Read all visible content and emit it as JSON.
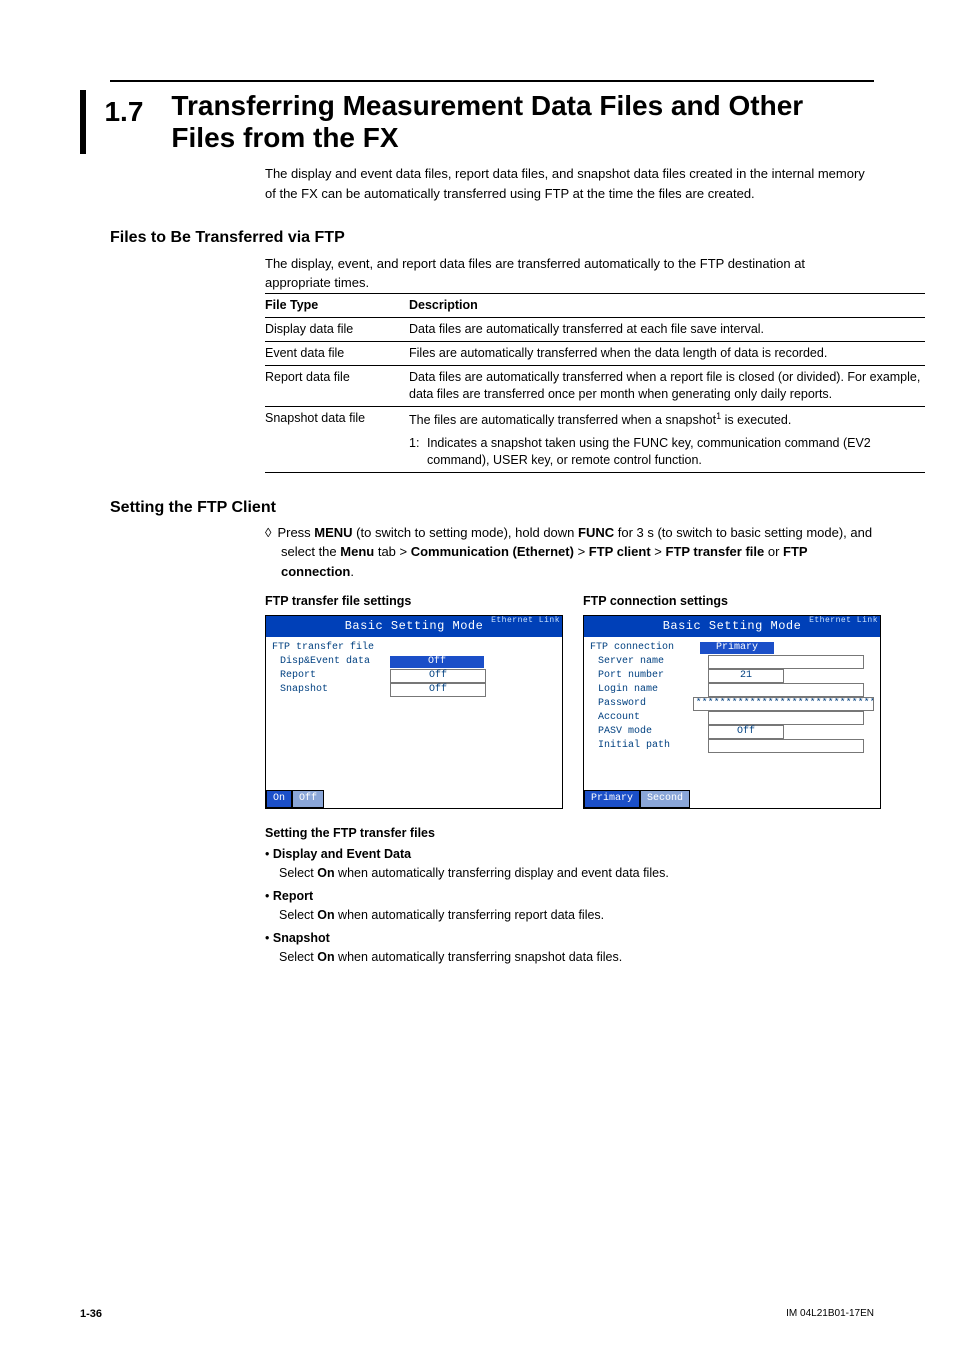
{
  "section_number": "1.7",
  "section_title": "Transferring Measurement Data Files and Other Files from the FX",
  "intro": "The display and event data files, report data files, and snapshot data files created in the internal memory of the FX can be automatically transferred using FTP at the time the files are created.",
  "subhead1": "Files to Be Transferred via FTP",
  "sub1_text": "The display, event, and report data files are transferred automatically to the FTP destination at appropriate times.",
  "table": {
    "h1": "File Type",
    "h2": "Description",
    "rows": [
      {
        "type": "Display data file",
        "desc": "Data files are automatically transferred at each file save interval."
      },
      {
        "type": "Event data file",
        "desc": "Files are automatically transferred when the data length of data is recorded."
      },
      {
        "type": "Report data file",
        "desc": "Data files are automatically transferred when a report file is closed (or divided). For example, data files are transferred once per month when generating only daily reports."
      },
      {
        "type": "Snapshot data file",
        "desc_pre": "The files are automatically transferred when a snapshot",
        "desc_post": " is executed.",
        "sup": "1"
      }
    ],
    "footnote_num": "1:",
    "footnote": "Indicates a snapshot taken using the FUNC key, communication command (EV2 command), USER key, or remote control function."
  },
  "subhead2": "Setting the FTP Client",
  "proc": {
    "diamond": "◊",
    "t1": "Press ",
    "menu": "MENU",
    "t2": " (to switch to setting mode), hold down ",
    "func": "FUNC",
    "t3": " for 3 s (to switch to basic setting mode), and select the ",
    "menu2": "Menu",
    "t4": " tab > ",
    "comm": "Communication (Ethernet)",
    "t5": " > ",
    "ftpc": "FTP client",
    "t6": " > ",
    "ftptf": "FTP transfer file",
    "or": " or ",
    "ftpconn": "FTP connection",
    "period": "."
  },
  "screens": {
    "left_title": "FTP transfer file settings",
    "right_title": "FTP connection settings",
    "header": "Basic Setting Mode",
    "linkicon": "Ethernet\nLink",
    "left": {
      "section": "FTP transfer file",
      "rows": [
        {
          "label": "Disp&Event data",
          "val": "Off"
        },
        {
          "label": "Report",
          "val": "Off"
        },
        {
          "label": "Snapshot",
          "val": "Off"
        }
      ],
      "keys": [
        "On",
        "Off"
      ]
    },
    "right": {
      "section": "FTP connection",
      "primary": "Primary",
      "rows": [
        {
          "label": "Server name",
          "val": ""
        },
        {
          "label": "Port number",
          "val": "21"
        },
        {
          "label": "Login name",
          "val": ""
        },
        {
          "label": "Password",
          "val": "**********************************"
        },
        {
          "label": "Account",
          "val": ""
        },
        {
          "label": "PASV mode",
          "val": "Off"
        },
        {
          "label": "Initial path",
          "val": ""
        }
      ],
      "keys": [
        "Primary",
        "Second"
      ]
    }
  },
  "subsub": "Setting the FTP transfer files",
  "items": [
    {
      "title": "Display and Event Data",
      "desc_pre": "Select ",
      "on": "On",
      "desc_post": " when automatically transferring display and event data files."
    },
    {
      "title": "Report",
      "desc_pre": "Select ",
      "on": "On",
      "desc_post": " when automatically transferring report data files."
    },
    {
      "title": "Snapshot",
      "desc_pre": "Select ",
      "on": "On",
      "desc_post": " when automatically transferring snapshot data files."
    }
  ],
  "footer": {
    "page": "1-36",
    "doc": "IM 04L21B01-17EN"
  }
}
